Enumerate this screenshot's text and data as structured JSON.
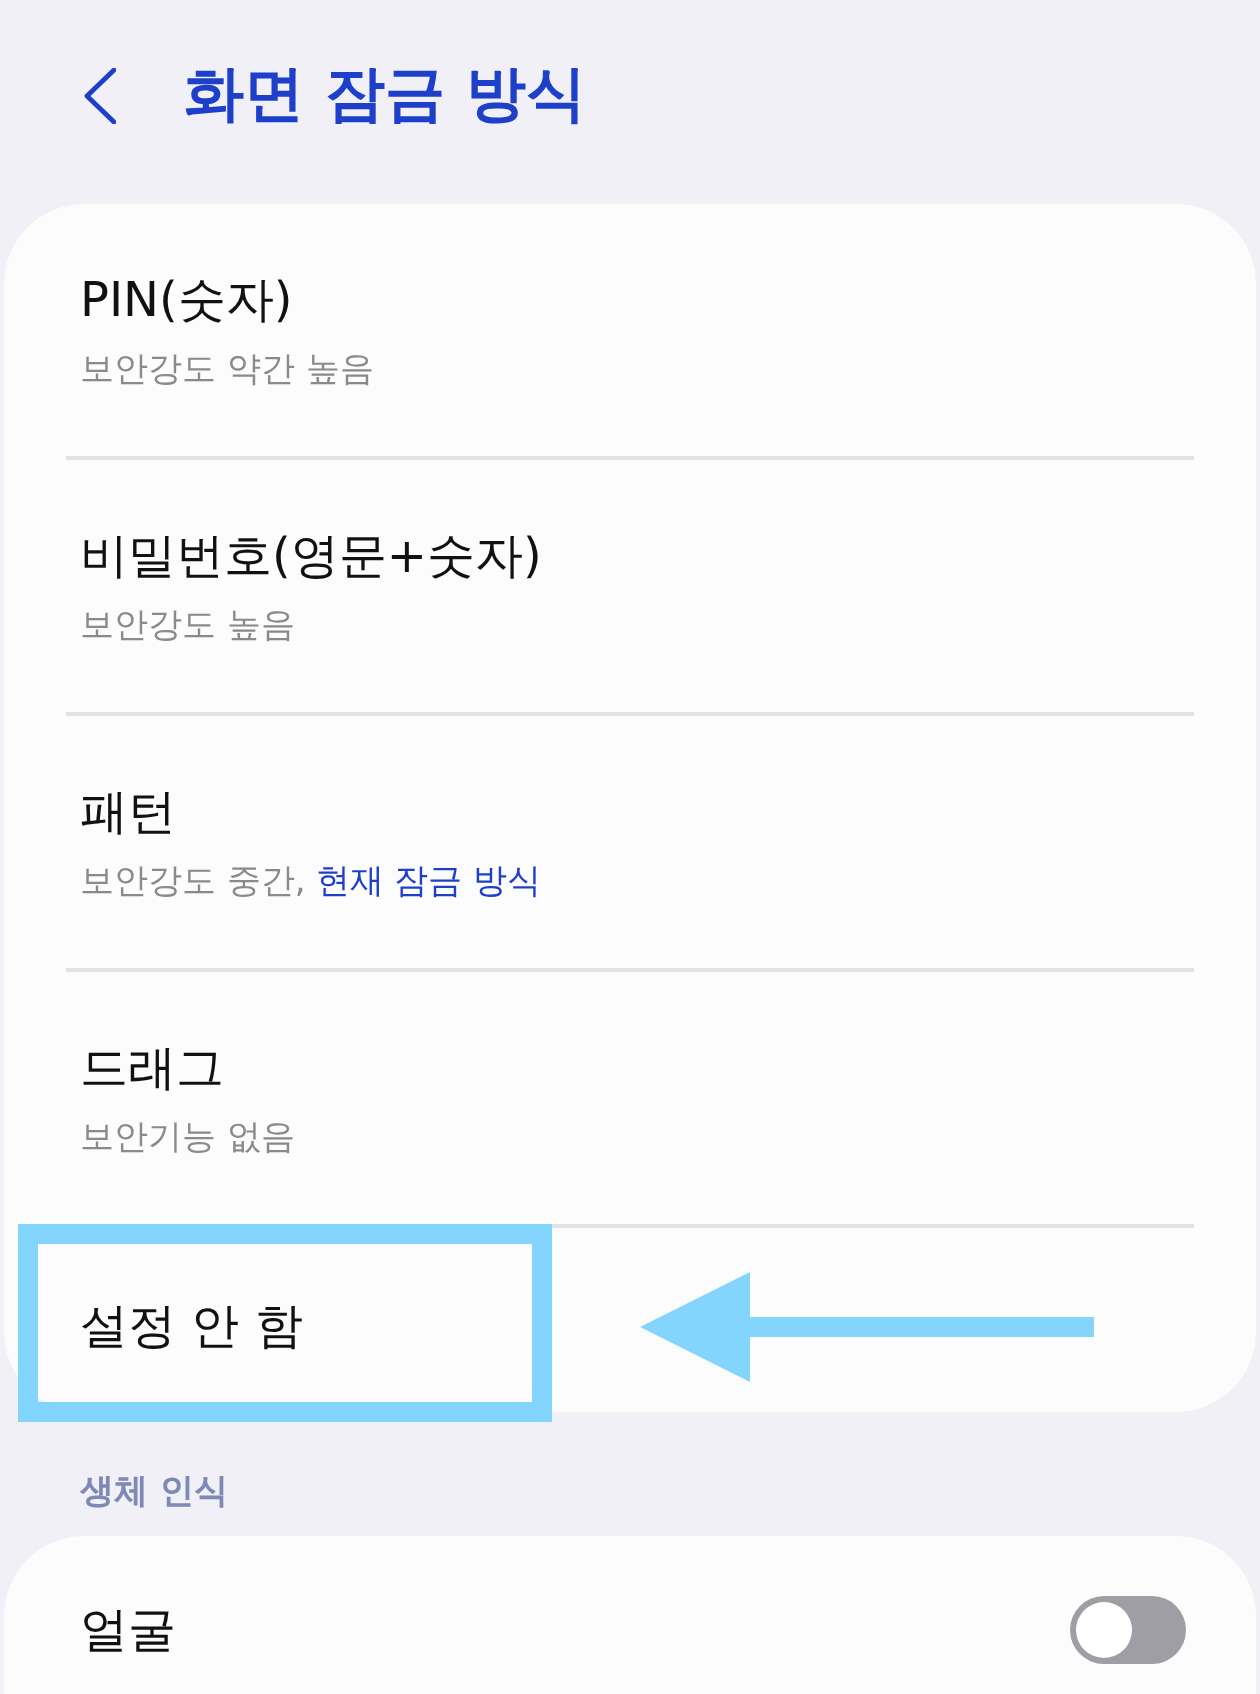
{
  "header": {
    "title": "화면 잠금 방식"
  },
  "lock_types": [
    {
      "title": "PIN(숫자)",
      "subtitle": "보안강도 약간 높음",
      "highlighted": false
    },
    {
      "title": "비밀번호(영문+숫자)",
      "subtitle": "보안강도 높음",
      "highlighted": false
    },
    {
      "title": "패턴",
      "subtitle": "보안강도 중간,",
      "current_label": "현재 잠금 방식",
      "highlighted": false
    },
    {
      "title": "드래그",
      "subtitle": "보안기능 없음",
      "highlighted": false
    },
    {
      "title": "설정 안 함",
      "highlighted": true
    }
  ],
  "biometrics": {
    "heading": "생체 인식",
    "items": [
      {
        "label": "얼굴",
        "on": false
      }
    ]
  }
}
